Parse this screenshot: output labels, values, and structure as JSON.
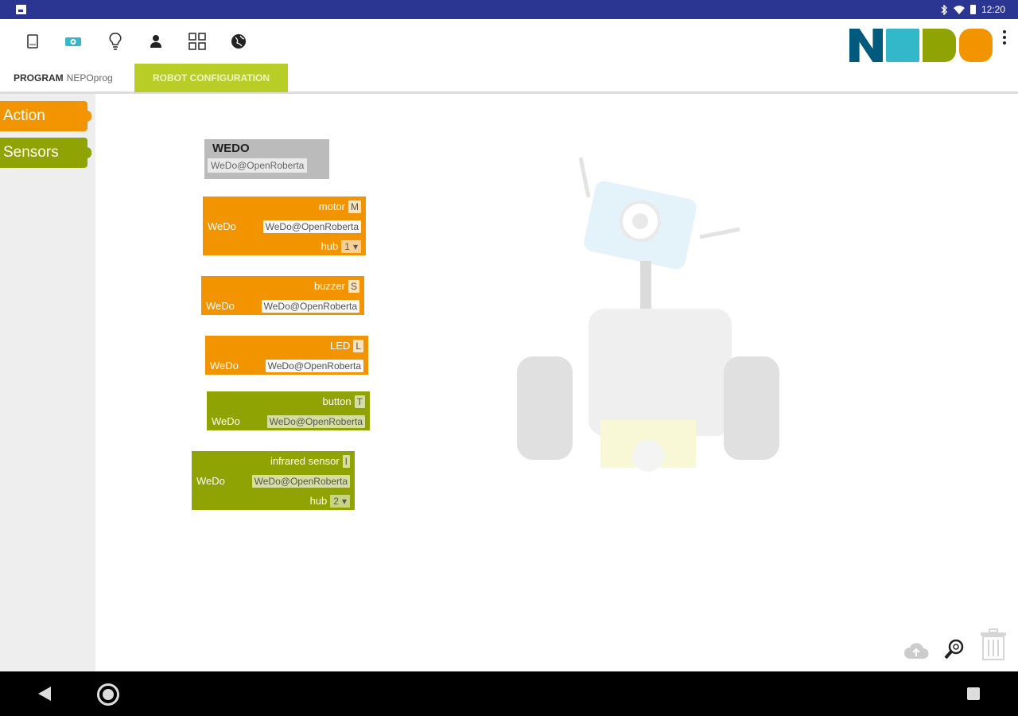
{
  "status_bar": {
    "time": "12:20",
    "icons": [
      "gallery-icon",
      "bluetooth-icon",
      "wifi-icon",
      "battery-icon"
    ]
  },
  "toolbar": {
    "icons": [
      "tablet-icon",
      "robot-icon",
      "lightbulb-icon",
      "user-icon",
      "apps-grid-icon",
      "globe-icon"
    ],
    "logo_name": "NEPO logo",
    "menu_icon": "overflow-menu-icon"
  },
  "tabs": {
    "program_label": "PROGRAM",
    "program_name": "NEPOprog",
    "robot_config_label": "ROBOT CONFIGURATION"
  },
  "toolbox": {
    "categories": [
      {
        "label": "Action",
        "color": "#f29400"
      },
      {
        "label": "Sensors",
        "color": "#8fa402"
      }
    ]
  },
  "workspace": {
    "wedo_block": {
      "title": "WEDO",
      "name": "WeDo@OpenRoberta"
    },
    "motor_block": {
      "label": "motor",
      "port": "M",
      "device": "WeDo",
      "device_name": "WeDo@OpenRoberta",
      "hub_label": "hub",
      "hub_value": "1"
    },
    "buzzer_block": {
      "label": "buzzer",
      "port": "S",
      "device": "WeDo",
      "device_name": "WeDo@OpenRoberta"
    },
    "led_block": {
      "label": "LED",
      "port": "L",
      "device": "WeDo",
      "device_name": "WeDo@OpenRoberta"
    },
    "button_block": {
      "label": "button",
      "port": "T",
      "device": "WeDo",
      "device_name": "WeDo@OpenRoberta"
    },
    "infrared_block": {
      "label": "infrared sensor",
      "port": "I",
      "device": "WeDo",
      "device_name": "WeDo@OpenRoberta",
      "hub_label": "hub",
      "hub_value": "2"
    },
    "controls": [
      "cloud-upload-icon",
      "zoom-reset-icon",
      "trash-icon"
    ]
  },
  "colors": {
    "action": "#f29400",
    "sensors": "#8fa402",
    "status_bar": "#2b3592",
    "tab_active": "#b8ce27"
  }
}
